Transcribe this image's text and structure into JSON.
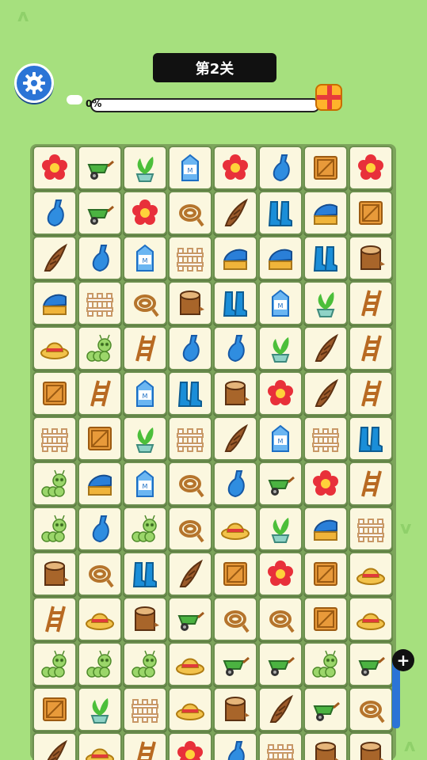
{
  "level": {
    "label": "第2关"
  },
  "progress": {
    "label": "0%",
    "value": 0
  },
  "colors": {
    "background": "#a6e07e",
    "tile": "#fbf7df",
    "settings": "#2b74d6"
  },
  "tiles": [
    [
      "flower",
      "wheelbarrow",
      "plant",
      "milk",
      "flower",
      "vase",
      "crate",
      "flower"
    ],
    [
      "vase",
      "wheelbarrow",
      "flower",
      "rope",
      "horn",
      "boots",
      "brush",
      "crate"
    ],
    [
      "horn",
      "vase",
      "milk",
      "fence",
      "brush",
      "brush",
      "boots",
      "stump"
    ],
    [
      "brush",
      "fence",
      "rope",
      "stump",
      "boots",
      "milk",
      "plant",
      "ladder"
    ],
    [
      "hat",
      "caterpillar",
      "ladder",
      "vase",
      "vase",
      "plant",
      "horn",
      "ladder"
    ],
    [
      "crate",
      "ladder",
      "milk",
      "boots",
      "stump",
      "flower",
      "horn",
      "ladder"
    ],
    [
      "fence",
      "crate",
      "plant",
      "fence",
      "horn",
      "milk",
      "fence",
      "boots"
    ],
    [
      "caterpillar",
      "brush",
      "milk",
      "rope",
      "vase",
      "wheelbarrow",
      "flower",
      "ladder"
    ],
    [
      "caterpillar",
      "vase",
      "caterpillar",
      "rope",
      "hat",
      "plant",
      "brush",
      "fence"
    ],
    [
      "stump",
      "rope",
      "boots",
      "horn",
      "crate",
      "flower",
      "crate",
      "hat"
    ],
    [
      "ladder",
      "hat",
      "stump",
      "wheelbarrow",
      "rope",
      "rope",
      "crate",
      "hat"
    ],
    [
      "caterpillar",
      "caterpillar",
      "caterpillar",
      "hat",
      "wheelbarrow",
      "wheelbarrow",
      "caterpillar",
      "wheelbarrow"
    ],
    [
      "crate",
      "plant",
      "fence",
      "hat",
      "stump",
      "horn",
      "wheelbarrow",
      "rope"
    ],
    [
      "horn",
      "hat",
      "ladder",
      "flower",
      "vase",
      "fence",
      "stump",
      "stump"
    ]
  ]
}
